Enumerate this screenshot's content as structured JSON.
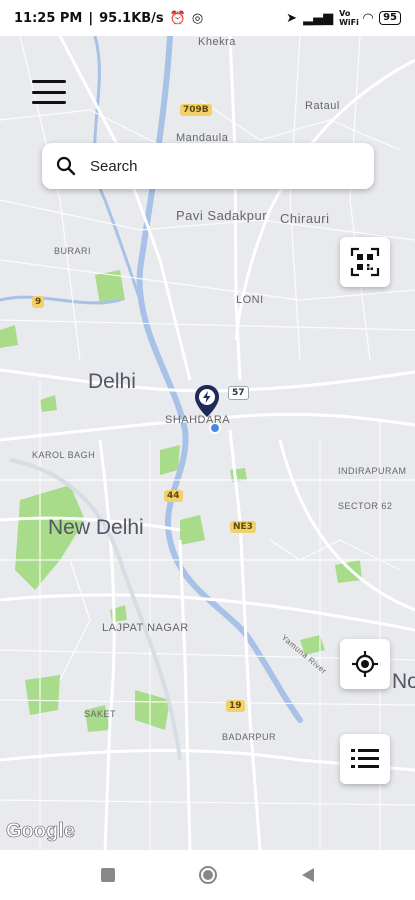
{
  "status_bar": {
    "time": "11:25 PM",
    "speed": "95.1KB/s",
    "network": "Vo WiFi",
    "battery": "95"
  },
  "search": {
    "placeholder": "Search"
  },
  "map": {
    "labels": {
      "khekra": "Khekra",
      "mandaula": "Mandaula",
      "rataul": "Rataul",
      "pavi_sadakpur": "Pavi Sadakpur",
      "chirauri": "Chirauri",
      "burari": "BURARI",
      "loni": "LONI",
      "delhi": "Delhi",
      "shahdara": "SHAHDARA",
      "karol_bagh": "KAROL BAGH",
      "indirapuram": "INDIRAPURAM",
      "sector62": "SECTOR 62",
      "new_delhi": "New Delhi",
      "lajpat_nagar": "LAJPAT NAGAR",
      "saket": "SAKET",
      "badarpur": "BADARPUR",
      "noida_partial": "Noi",
      "yamuna_river": "Yamuna River"
    },
    "shields": {
      "s709b": "709B",
      "s9": "9",
      "s57": "57",
      "s44": "44",
      "ne3": "NE3",
      "s19": "19"
    },
    "attribution": "Google"
  },
  "icons": {
    "menu": "hamburger-menu-icon",
    "search": "search-icon",
    "qr": "qr-scan-icon",
    "location": "my-location-icon",
    "list": "list-icon",
    "pin": "charging-station-pin-icon"
  }
}
